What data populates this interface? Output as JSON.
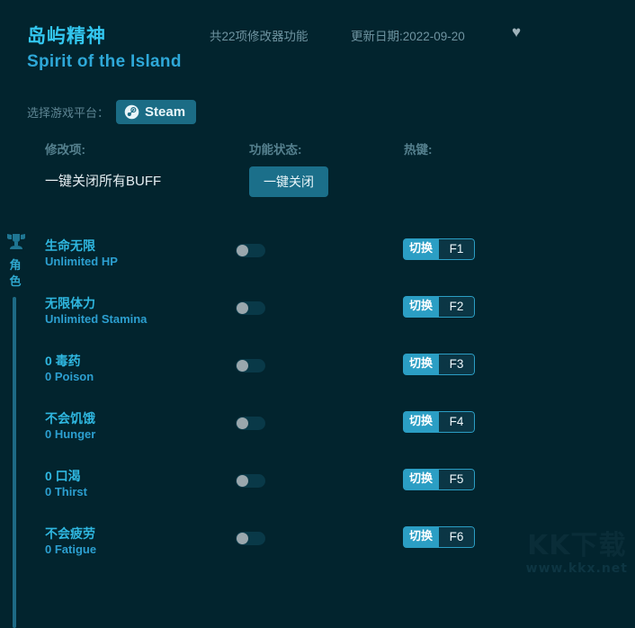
{
  "header": {
    "game_title_cn": "岛屿精神",
    "game_title_en": "Spirit of the Island",
    "feature_count": "共22项修改器功能",
    "update_date": "更新日期:2022-09-20",
    "favorite_icon": "♥"
  },
  "platform": {
    "label": "选择游戏平台：",
    "selected": "Steam",
    "icon": "steam-icon"
  },
  "columns": {
    "name": "修改项:",
    "status": "功能状态:",
    "hotkey": "热键:"
  },
  "onekey": {
    "label": "一键关闭所有BUFF",
    "button": "一键关闭"
  },
  "category": {
    "label": "角色",
    "icon": "character-helmet-icon"
  },
  "rows": [
    {
      "name_cn": "生命无限",
      "name_en": "Unlimited HP",
      "toggle": "off",
      "hotkey_action": "切换",
      "hotkey_key": "F1"
    },
    {
      "name_cn": "无限体力",
      "name_en": "Unlimited Stamina",
      "toggle": "off",
      "hotkey_action": "切换",
      "hotkey_key": "F2"
    },
    {
      "name_cn": "0 毒药",
      "name_en": "0 Poison",
      "toggle": "off",
      "hotkey_action": "切换",
      "hotkey_key": "F3"
    },
    {
      "name_cn": "不会饥饿",
      "name_en": "0 Hunger",
      "toggle": "off",
      "hotkey_action": "切换",
      "hotkey_key": "F4"
    },
    {
      "name_cn": "0 口渴",
      "name_en": "0 Thirst",
      "toggle": "off",
      "hotkey_action": "切换",
      "hotkey_key": "F5"
    },
    {
      "name_cn": "不会疲劳",
      "name_en": "0 Fatigue",
      "toggle": "off",
      "hotkey_action": "切换",
      "hotkey_key": "F6"
    }
  ],
  "watermark": {
    "main": "KK下载",
    "sub": "www.kkx.net"
  },
  "colors": {
    "background": "#02242e",
    "accent_cyan": "#33c7f0",
    "accent_teal": "#2b9ec4",
    "button_teal": "#1b6c85",
    "muted_text": "#6f93a0"
  }
}
